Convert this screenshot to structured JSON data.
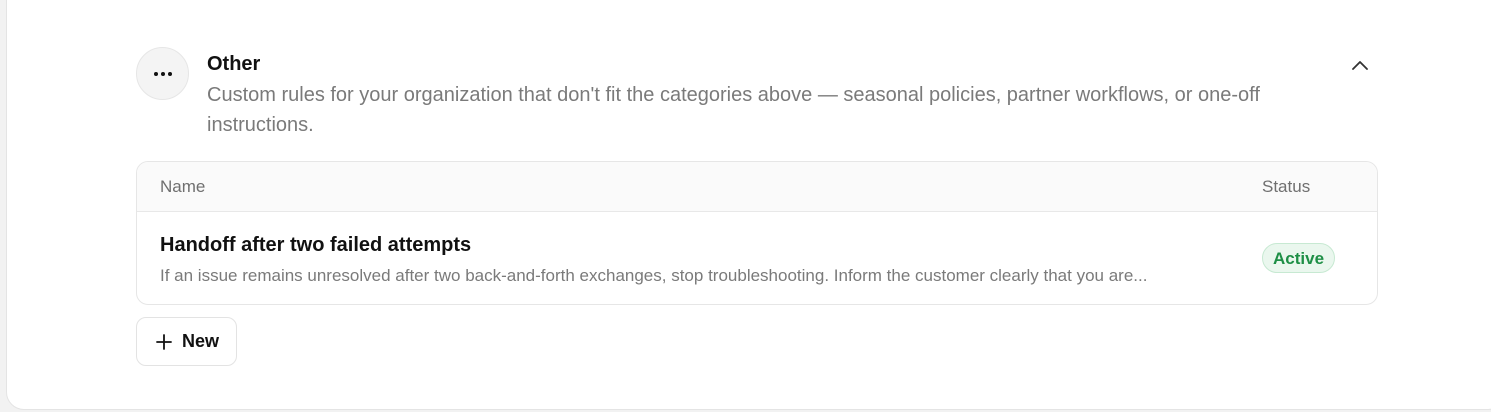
{
  "section": {
    "title": "Other",
    "description": "Custom rules for your organization that don't fit the categories above — seasonal policies, partner workflows, or one-off instructions.",
    "icon": "more-horizontal-icon",
    "collapse_icon": "chevron-up-icon"
  },
  "table": {
    "columns": {
      "name": "Name",
      "status": "Status"
    },
    "rows": [
      {
        "title": "Handoff after two failed attempts",
        "description": "If an issue remains unresolved after two back-and-forth exchanges, stop troubleshooting. Inform the customer clearly that you are...",
        "status": "Active"
      }
    ]
  },
  "actions": {
    "new_label": "New",
    "new_icon": "plus-icon"
  },
  "colors": {
    "status_active_text": "#1e8f46",
    "status_active_bg": "#eaf7ee"
  }
}
